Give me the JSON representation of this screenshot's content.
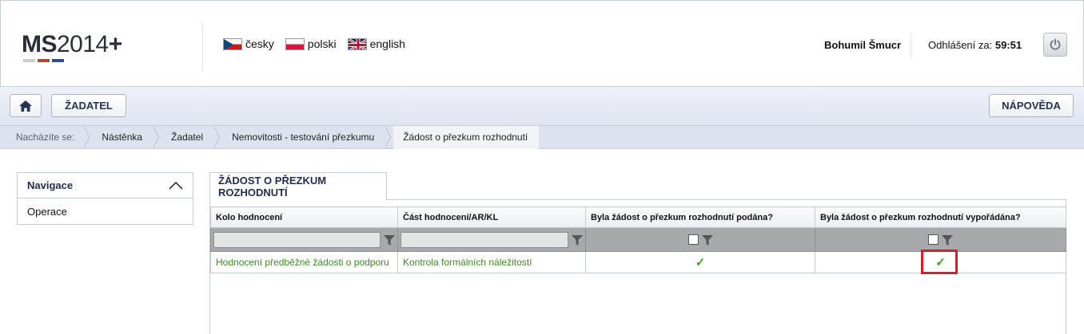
{
  "header": {
    "logo_ms": "MS",
    "logo_year": "2014",
    "logo_plus": "+",
    "logo_bar_colors": [
      "#c9cbd0",
      "#b5472c",
      "#2e4f8f"
    ],
    "languages": [
      {
        "label": "česky",
        "flag": "flag-cz-icon"
      },
      {
        "label": "polski",
        "flag": "flag-pl-icon"
      },
      {
        "label": "english",
        "flag": "flag-uk-icon"
      }
    ],
    "user_name": "Bohumil Šmucr",
    "logout_label": "Odhlášení za:",
    "logout_timer": "59:51"
  },
  "toolbar": {
    "home_icon": "home-icon",
    "zadatel_label": "ŽADATEL",
    "help_label": "NÁPOVĚDA"
  },
  "breadcrumb": {
    "label": "Nacházíte se:",
    "items": [
      "Nástěnka",
      "Žadatel",
      "Nemovitosti - testování přezkumu",
      "Žádost o přezkum rozhodnutí"
    ]
  },
  "navigation": {
    "title": "Navigace",
    "items": [
      "Operace"
    ]
  },
  "main": {
    "tab_label": "ŽÁDOST O PŘEZKUM ROZHODNUTÍ",
    "columns": [
      "Kolo hodnocení",
      "Část hodnocení/AR/KL",
      "Byla žádost o přezkum rozhodnutí podána?",
      "Byla žádost o přezkum rozhodnutí vypořádána?"
    ],
    "rows": [
      {
        "kolo": "Hodnocení předběžné žádosti o podporu",
        "cast": "Kontrola formálních náležitostí",
        "podana": "✓",
        "vyporadana": "✓"
      }
    ]
  },
  "colors": {
    "accent_text": "#1f2c4f",
    "link_green": "#3a8f1d",
    "highlight_red": "#e01b24"
  }
}
